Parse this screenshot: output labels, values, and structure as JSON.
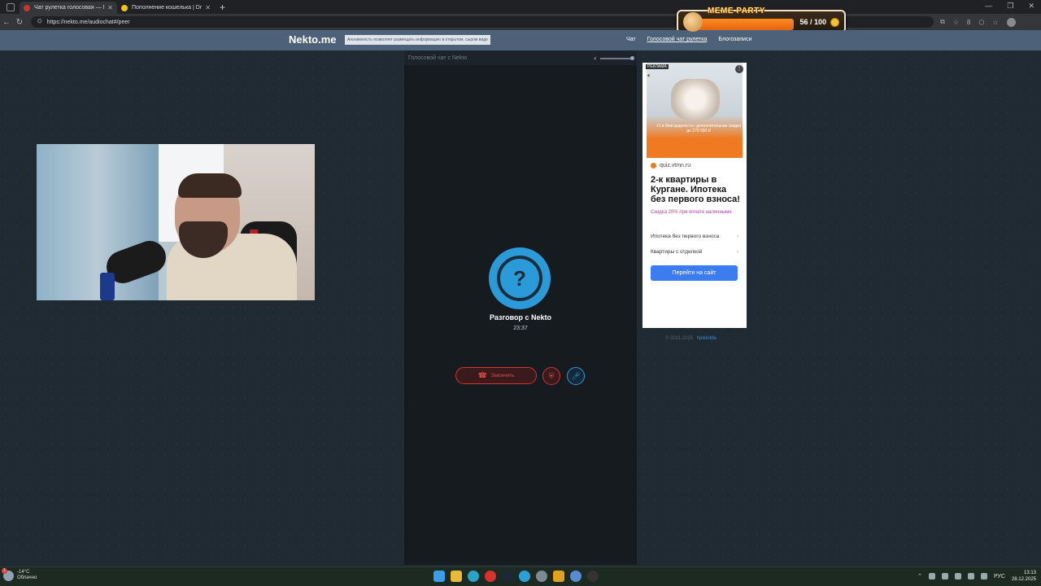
{
  "browser": {
    "tabs": [
      {
        "title": "Чат рулетка голосовая — N",
        "favicon_color": "#c0392b",
        "active": true
      },
      {
        "title": "Пополнение кошелька | Dragon",
        "favicon_color": "#f1c40f",
        "active": false
      }
    ],
    "url": "https://nekto.me/audiochat#/peer",
    "extensions_count": "8"
  },
  "overlay": {
    "title": "MEME PARTY",
    "counter": "56 / 100"
  },
  "site": {
    "logo": "Nekto.me",
    "tagline": "Анонимность позволяет размещать информацию в открытом, сыром виде",
    "nav": [
      "Чат",
      "Голосовой чат рулетка",
      "Блогозаписи"
    ]
  },
  "chat": {
    "header": "Голосовой чат с Nekto",
    "avatar_symbol": "?",
    "conversation_title": "Разговор с Nekto",
    "timer": "23:37",
    "end_button": "Закончить"
  },
  "ad": {
    "label": "РЕКЛАМА",
    "offer": "«1 в благодарность» дополнительная скидка до 270 000 ₽",
    "domain": "quiz.vtmn.ru",
    "headline": "2-к квартиры в Кургане. Ипотека без первого взноса!",
    "discount": "Скидка 20% при оплате наличными",
    "links": [
      "Ипотека без первого взноса",
      "Квартиры с отделкой"
    ],
    "cta": "Перейти на сайт"
  },
  "footer": {
    "copyright": "© 2011-2025",
    "link": "NektoMe"
  },
  "taskbar": {
    "weather_temp": "-14°C",
    "weather_desc": "Облачно",
    "weather_badge": "1",
    "lang": "РУС",
    "time": "13:13",
    "date": "28.12.2025"
  }
}
